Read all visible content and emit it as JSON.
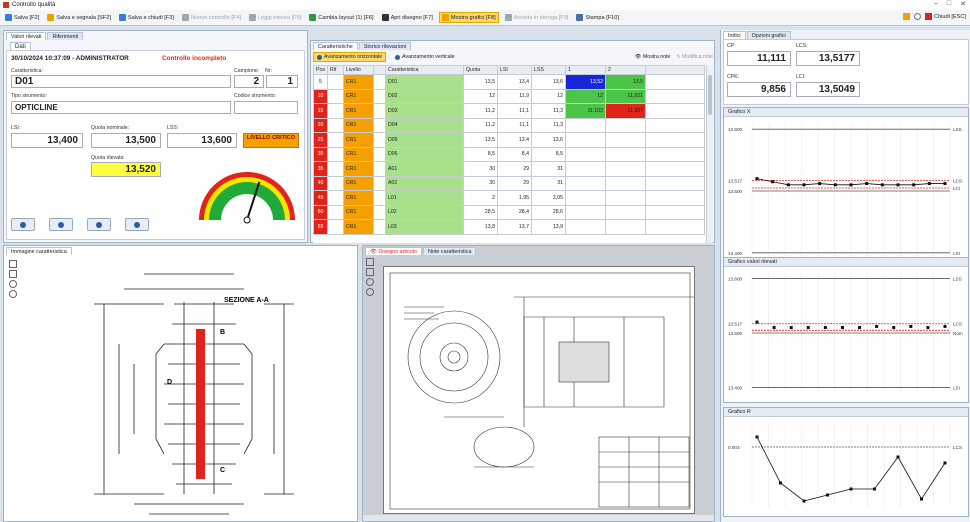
{
  "window": {
    "title": "Controllo qualità"
  },
  "toolbar": {
    "items": [
      {
        "label": "Salva [F2]",
        "color": "#3a7bd5",
        "disabled": false
      },
      {
        "label": "Salva e segnala [SF2]",
        "color": "#e8a400",
        "disabled": false
      },
      {
        "label": "Salva e chiudi [F3]",
        "color": "#3a7bd5",
        "disabled": false
      },
      {
        "label": "Nuovo controllo [F4]",
        "color": "#9aa",
        "disabled": true
      },
      {
        "label": "Leggi misura [F5]",
        "color": "#9aa",
        "disabled": true
      },
      {
        "label": "Cambia layout (1) [F6]",
        "color": "#2a9d3a",
        "disabled": false
      },
      {
        "label": "Apri disegno [F7]",
        "color": "#333",
        "disabled": false
      },
      {
        "label": "Mostra grafici [F8]",
        "color": "#e8a400",
        "disabled": false,
        "highlight": true
      },
      {
        "label": "Accetta in deroga [F9]",
        "color": "#9aa",
        "disabled": true
      },
      {
        "label": "Stampa [F10]",
        "color": "#4a6fa5",
        "disabled": false
      }
    ],
    "close_label": "Chiudi [ESC]"
  },
  "left": {
    "tabs": [
      "Valori rilevati",
      "Riferimenti"
    ],
    "subtab": "Dati",
    "header": "30/10/2024 10:37:09 - ADMINISTRATOR",
    "status": "Controllo incompleto",
    "caratteristica_label": "Caratteristica:",
    "caratteristica": "D01",
    "campione_label": "Campione:",
    "campione": "2",
    "nr_label": "Nr:",
    "nr": "1",
    "tipo_label": "Tipo strumento:",
    "tipo": "OPTICLINE",
    "codice_label": "Codice strumento:",
    "lsi_label": "LSI:",
    "lsi": "13,400",
    "nom_label": "Quota nominale:",
    "nom": "13,500",
    "lss_label": "LSS:",
    "lss": "13,600",
    "level": "LIVELLO CRITICO",
    "ril_label": "Quota rilevata:",
    "ril": "13,520",
    "gauge_value_fraction": 0.6
  },
  "table": {
    "tabs": [
      "Caratteristiche",
      "Storico rilevazioni"
    ],
    "btn_h": "Avanzamento orizzontale",
    "btn_v": "Avanzamento verticale",
    "show_notes": "Mostra note",
    "edit_notes": "Modifica note",
    "headers": [
      "Pos",
      "Rif",
      "Livello",
      "Caratteristica",
      "Quota",
      "LSI",
      "LSS",
      "1",
      "2"
    ],
    "rows": [
      {
        "pos": "5",
        "liv": "CR1",
        "car": "D01",
        "q": "13,5",
        "lsi": "13,4",
        "lss": "13,6",
        "v1": "13,52",
        "v2": "13,5",
        "c1": "#1726d8",
        "c2": "#4cc447"
      },
      {
        "pos": "10",
        "liv": "CR1",
        "car": "D02",
        "q": "12",
        "lsi": "11,9",
        "lss": "12",
        "v1": "12",
        "v2": "11,921",
        "c1": "#4cc447",
        "c2": "#4cc447"
      },
      {
        "pos": "15",
        "liv": "CR1",
        "car": "D03",
        "q": "11,2",
        "lsi": "11,1",
        "lss": "11,3",
        "v1": "11,103",
        "v2": "11,307",
        "c1": "#4cc447",
        "c2": "#e0241c"
      },
      {
        "pos": "20",
        "liv": "CR1",
        "car": "D04",
        "q": "11,2",
        "lsi": "11,1",
        "lss": "11,3",
        "v1": "",
        "v2": "",
        "c1": "",
        "c2": ""
      },
      {
        "pos": "25",
        "liv": "CR1",
        "car": "D05",
        "q": "13,5",
        "lsi": "13,4",
        "lss": "13,6",
        "v1": "",
        "v2": "",
        "c1": "",
        "c2": ""
      },
      {
        "pos": "30",
        "liv": "CR1",
        "car": "D06",
        "q": "8,5",
        "lsi": "8,4",
        "lss": "8,5",
        "v1": "",
        "v2": "",
        "c1": "",
        "c2": ""
      },
      {
        "pos": "35",
        "liv": "CR1",
        "car": "A01",
        "q": "30",
        "lsi": "29",
        "lss": "31",
        "v1": "",
        "v2": "",
        "c1": "",
        "c2": ""
      },
      {
        "pos": "40",
        "liv": "CR1",
        "car": "A02",
        "q": "30",
        "lsi": "29",
        "lss": "31",
        "v1": "",
        "v2": "",
        "c1": "",
        "c2": ""
      },
      {
        "pos": "45",
        "liv": "CR1",
        "car": "L01",
        "q": "2",
        "lsi": "1,95",
        "lss": "2,05",
        "v1": "",
        "v2": "",
        "c1": "",
        "c2": ""
      },
      {
        "pos": "50",
        "liv": "CR1",
        "car": "L02",
        "q": "28,5",
        "lsi": "28,4",
        "lss": "28,6",
        "v1": "",
        "v2": "",
        "c1": "",
        "c2": ""
      },
      {
        "pos": "55",
        "liv": "CR1",
        "car": "L03",
        "q": "13,8",
        "lsi": "13,7",
        "lss": "13,9",
        "v1": "",
        "v2": "",
        "c1": "",
        "c2": ""
      }
    ]
  },
  "image_panel": {
    "title": "Immagine caratteristica",
    "section": "SEZIONE A-A",
    "labels": [
      "B",
      "C",
      "D"
    ]
  },
  "drawing_panel": {
    "tabs": [
      "Disegno articolo",
      "Note caratteristica"
    ]
  },
  "right": {
    "tabs": [
      "Indici",
      "Opzioni grafici"
    ],
    "cp_label": "CP:",
    "cp": "11,111",
    "lcs1_label": "LCS:",
    "lcs1": "13,5177",
    "cpk_label": "CPK:",
    "cpk": "9,856",
    "lcs2_label": "LCI:",
    "lcs2": "13,5049",
    "gx_title": "Grafico X",
    "gv_title": "Grafico valori rilevati",
    "gr_title": "Grafico R"
  },
  "chart_data": [
    {
      "type": "line",
      "title": "Grafico X",
      "y_ticks": [
        "13.600",
        "13.517",
        "13.500",
        "13.400"
      ],
      "right_labels": [
        "LSS",
        "LCS",
        "LCI",
        "LSI"
      ],
      "values": [
        13.52,
        13.515,
        13.51,
        13.51,
        13.512,
        13.51,
        13.51,
        13.512,
        13.51,
        13.51,
        13.51,
        13.512,
        13.512
      ]
    },
    {
      "type": "scatter",
      "title": "Grafico valori rilevati",
      "y_ticks": [
        "13.600",
        "13.517",
        "13.500",
        "13.400"
      ],
      "right_labels": [
        "LSS",
        "LCS",
        "Nom",
        "LSI"
      ],
      "values": [
        13.52,
        13.51,
        13.51,
        13.51,
        13.51,
        13.51,
        13.51,
        13.512,
        13.51,
        13.512,
        13.51,
        13.512
      ]
    },
    {
      "type": "line",
      "title": "Grafico R",
      "y_ticks": [
        "0.003"
      ],
      "right_labels": [
        "LCS"
      ],
      "values": [
        0.0035,
        0.0012,
        0.0003,
        0.0006,
        0.0009,
        0.0009,
        0.0025,
        0.0004,
        0.0022
      ]
    }
  ],
  "colors": {
    "accent": "#e8a400",
    "critical": "#f5a000",
    "ok": "#4cc447",
    "ko": "#e0241c",
    "hl": "#ffff40"
  }
}
